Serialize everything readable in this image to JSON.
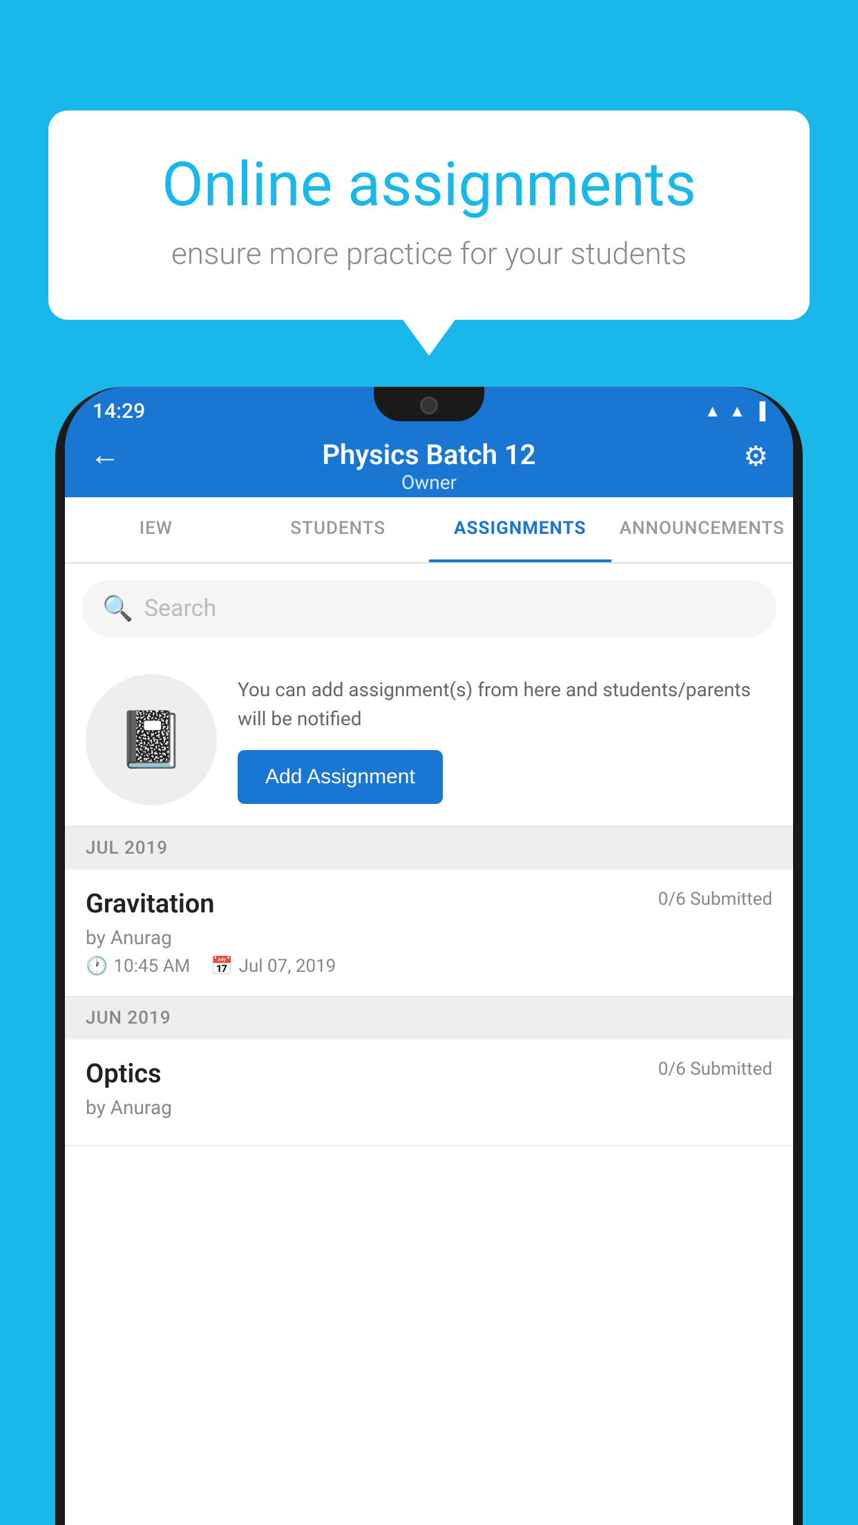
{
  "background_color": "#1ab7ea",
  "speech_bubble": {
    "title": "Online assignments",
    "subtitle": "ensure more practice for your students"
  },
  "status_bar": {
    "time": "14:29",
    "icons": [
      "wifi",
      "signal",
      "battery"
    ]
  },
  "app_header": {
    "title": "Physics Batch 12",
    "subtitle": "Owner",
    "back_icon": "←",
    "settings_icon": "⚙"
  },
  "tabs": [
    {
      "label": "IEW",
      "active": false
    },
    {
      "label": "STUDENTS",
      "active": false
    },
    {
      "label": "ASSIGNMENTS",
      "active": true
    },
    {
      "label": "ANNOUNCEMENTS",
      "active": false
    }
  ],
  "search": {
    "placeholder": "Search"
  },
  "promo": {
    "description": "You can add assignment(s) from here and students/parents will be notified",
    "button_label": "Add Assignment"
  },
  "sections": [
    {
      "header": "JUL 2019",
      "assignments": [
        {
          "title": "Gravitation",
          "submitted": "0/6 Submitted",
          "by": "by Anurag",
          "time": "10:45 AM",
          "date": "Jul 07, 2019"
        }
      ]
    },
    {
      "header": "JUN 2019",
      "assignments": [
        {
          "title": "Optics",
          "submitted": "0/6 Submitted",
          "by": "by Anurag",
          "time": "",
          "date": ""
        }
      ]
    }
  ]
}
